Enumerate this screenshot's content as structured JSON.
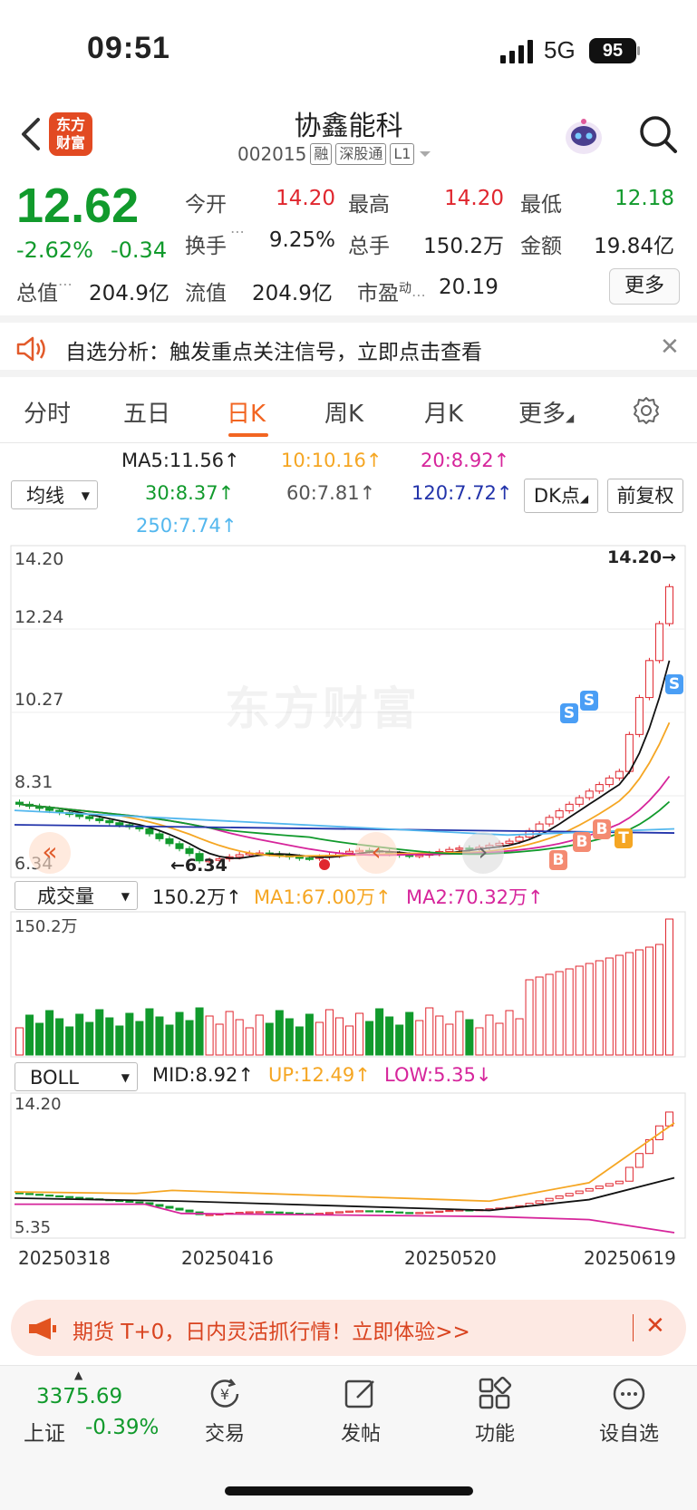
{
  "status_bar": {
    "time": "09:51",
    "network": "5G",
    "battery": "95"
  },
  "header": {
    "app_logo": "东方\n财富",
    "stock_name": "协鑫能科",
    "stock_code": "002015",
    "tags": [
      "融",
      "深股通",
      "L1"
    ]
  },
  "quote": {
    "price": "12.62",
    "change_pct": "-2.62%",
    "change": "-0.34",
    "total_value_label": "总值",
    "total_value": "204.9亿",
    "fields": [
      {
        "label": "今开",
        "value": "14.20",
        "color": "#e0262e"
      },
      {
        "label": "最高",
        "value": "14.20",
        "color": "#e0262e"
      },
      {
        "label": "最低",
        "value": "12.18",
        "color": "#119a2c"
      },
      {
        "label": "换手",
        "value": "9.25%",
        "color": "#222222"
      },
      {
        "label": "总手",
        "value": "150.2万",
        "color": "#222222"
      },
      {
        "label": "金额",
        "value": "19.84亿",
        "color": "#222222"
      },
      {
        "label": "流值",
        "value": "204.9亿",
        "color": "#222222"
      },
      {
        "label": "市盈",
        "value": "20.19",
        "color": "#222222"
      }
    ],
    "pe_superscript": "动",
    "more_button": "更多"
  },
  "alert": {
    "text": "自选分析：触发重点关注信号，立即点击查看"
  },
  "tabs": [
    "分时",
    "五日",
    "日K",
    "周K",
    "月K",
    "更多"
  ],
  "active_tab": "日K",
  "ma_legend": {
    "selector": "均线",
    "items": [
      {
        "text": "MA5:11.56",
        "color": "#111111"
      },
      {
        "text": "10:10.16",
        "color": "#f5a623"
      },
      {
        "text": "20:8.92",
        "color": "#d6259b"
      },
      {
        "text": "30:8.37",
        "color": "#119a2c"
      },
      {
        "text": "60:7.81",
        "color": "#555555"
      },
      {
        "text": "120:7.72",
        "color": "#2233aa"
      },
      {
        "text": "250:7.74",
        "color": "#53b7ee"
      }
    ],
    "dk_button": "DK点",
    "fq_button": "前复权"
  },
  "kline": {
    "y_labels": [
      "14.20",
      "12.24",
      "10.27",
      "8.31",
      "6.34"
    ],
    "max_marker": "14.20→",
    "min_marker": "←6.34",
    "watermark": "东方财富",
    "signals": [
      "S",
      "S",
      "S",
      "B",
      "B",
      "B",
      "T"
    ]
  },
  "volume": {
    "selector": "成交量",
    "value": "150.2万",
    "ma1": "MA1:67.00万",
    "ma2": "MA2:70.32万",
    "y_label": "150.2万"
  },
  "boll": {
    "selector": "BOLL",
    "mid": "MID:8.92",
    "up": "UP:12.49",
    "low": "LOW:5.35",
    "y_top": "14.20",
    "y_bottom": "5.35"
  },
  "dates": [
    "20250318",
    "20250416",
    "20250520",
    "20250619"
  ],
  "promo": {
    "text": "期货 T+0，日内灵活抓行情！立即体验>>"
  },
  "bottom_nav": {
    "index_value": "3375.69",
    "index_name": "上证",
    "index_pct": "-0.39%",
    "items": [
      "交易",
      "发帖",
      "功能",
      "设自选"
    ]
  }
}
